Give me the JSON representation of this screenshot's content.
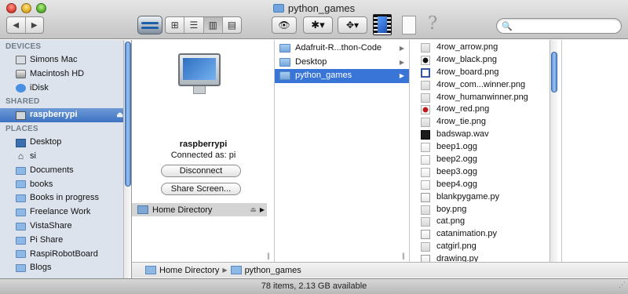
{
  "window": {
    "title": "python_games"
  },
  "toolbar": {
    "back_glyph": "◀",
    "forward_glyph": "▶",
    "view_icons": [
      "⊞",
      "☰",
      "▥",
      "▤"
    ],
    "eye_glyph": "👁",
    "gear_glyph": "✱▾",
    "dropbox_glyph": "✥▾",
    "help_glyph": "?",
    "search_glyph": "🔍",
    "search_value": ""
  },
  "sidebar": {
    "devices_header": "DEVICES",
    "devices": [
      {
        "label": "Simons Mac",
        "icon": "mac-icon"
      },
      {
        "label": "Macintosh HD",
        "icon": "hard-drive-icon"
      },
      {
        "label": "iDisk",
        "icon": "idisk-icon"
      }
    ],
    "shared_header": "SHARED",
    "shared": [
      {
        "label": "raspberrypi",
        "icon": "monitor-icon",
        "eject": "⏏"
      }
    ],
    "places_header": "PLACES",
    "places": [
      {
        "label": "Desktop",
        "icon": "desktop-icon"
      },
      {
        "label": "si",
        "icon": "home-icon",
        "glyph": "⌂"
      },
      {
        "label": "Documents",
        "icon": "folder-icon"
      },
      {
        "label": "books",
        "icon": "folder-icon"
      },
      {
        "label": "Books in progress",
        "icon": "folder-icon"
      },
      {
        "label": "Freelance Work",
        "icon": "folder-icon"
      },
      {
        "label": "VistaShare",
        "icon": "folder-icon"
      },
      {
        "label": "Pi Share",
        "icon": "folder-icon"
      },
      {
        "label": "RaspiRobotBoard",
        "icon": "folder-icon"
      },
      {
        "label": "Blogs",
        "icon": "folder-icon"
      }
    ]
  },
  "server_column": {
    "host": "raspberrypi",
    "connected_as": "Connected as: pi",
    "disconnect_label": "Disconnect",
    "share_screen_label": "Share Screen...",
    "home_directory_label": "Home Directory",
    "eject": "⏏",
    "arrow": "▶"
  },
  "folder_column": {
    "items": [
      {
        "label": "Adafruit-R...thon-Code",
        "selected": false
      },
      {
        "label": "Desktop",
        "selected": false
      },
      {
        "label": "python_games",
        "selected": true
      }
    ],
    "chevron": "▶"
  },
  "files_column": {
    "files": [
      {
        "name": "4row_arrow.png",
        "kind": "png"
      },
      {
        "name": "4row_black.png",
        "kind": "black"
      },
      {
        "name": "4row_board.png",
        "kind": "board"
      },
      {
        "name": "4row_com...winner.png",
        "kind": "png"
      },
      {
        "name": "4row_humanwinner.png",
        "kind": "png"
      },
      {
        "name": "4row_red.png",
        "kind": "red"
      },
      {
        "name": "4row_tie.png",
        "kind": "png"
      },
      {
        "name": "badswap.wav",
        "kind": "wav"
      },
      {
        "name": "beep1.ogg",
        "kind": "ogg"
      },
      {
        "name": "beep2.ogg",
        "kind": "ogg"
      },
      {
        "name": "beep3.ogg",
        "kind": "ogg"
      },
      {
        "name": "beep4.ogg",
        "kind": "ogg"
      },
      {
        "name": "blankpygame.py",
        "kind": "py"
      },
      {
        "name": "boy.png",
        "kind": "png"
      },
      {
        "name": "cat.png",
        "kind": "png"
      },
      {
        "name": "catanimation.py",
        "kind": "py"
      },
      {
        "name": "catgirl.png",
        "kind": "png"
      },
      {
        "name": "drawing.py",
        "kind": "py"
      }
    ]
  },
  "pathbar": {
    "segments": [
      "Home Directory",
      "python_games"
    ],
    "separator": "▶"
  },
  "status": {
    "text": "78 items, 2.13 GB available"
  },
  "column_grip": "||",
  "resize_grip": "⋰"
}
